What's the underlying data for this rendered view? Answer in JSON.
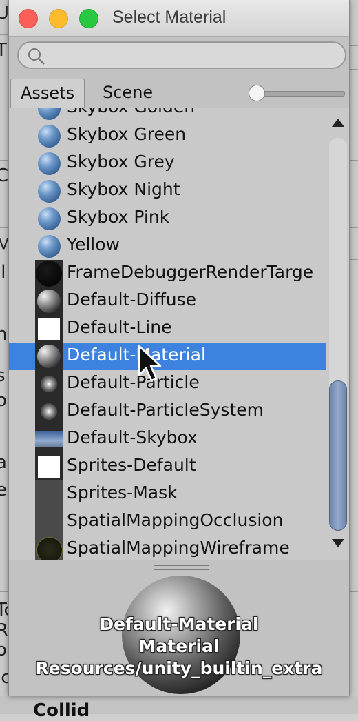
{
  "window": {
    "title": "Select Material"
  },
  "search": {
    "placeholder": ""
  },
  "tabs": [
    {
      "label": "Assets"
    },
    {
      "label": "Scene"
    }
  ],
  "materials": [
    {
      "label": "Skybox Golden",
      "thumb": "blue-sphere"
    },
    {
      "label": "Skybox Green",
      "thumb": "blue-sphere"
    },
    {
      "label": "Skybox Grey",
      "thumb": "blue-sphere"
    },
    {
      "label": "Skybox Night",
      "thumb": "blue-sphere"
    },
    {
      "label": "Skybox Pink",
      "thumb": "blue-sphere"
    },
    {
      "label": "Yellow",
      "thumb": "blue-sphere"
    },
    {
      "label": "FrameDebuggerRenderTarge",
      "thumb": "black-sphere"
    },
    {
      "label": "Default-Diffuse",
      "thumb": "grey-sphere"
    },
    {
      "label": "Default-Line",
      "thumb": "white-square"
    },
    {
      "label": "Default-Material",
      "thumb": "grey-sphere",
      "selected": true
    },
    {
      "label": "Default-Particle",
      "thumb": "particle-glow"
    },
    {
      "label": "Default-ParticleSystem",
      "thumb": "particle-glow"
    },
    {
      "label": "Default-Skybox",
      "thumb": "skybox-gradient"
    },
    {
      "label": "Sprites-Default",
      "thumb": "white-square"
    },
    {
      "label": "Sprites-Mask",
      "thumb": "dark-grey"
    },
    {
      "label": "SpatialMappingOcclusion",
      "thumb": "dark-grey"
    },
    {
      "label": "SpatialMappingWireframe",
      "thumb": "wireframe-sphere"
    }
  ],
  "preview": {
    "name": "Default-Material",
    "type": "Material",
    "path": "Resources/unity_builtin_extra"
  },
  "colors": {
    "selection": "#3e82e0",
    "scroll_thumb": "#7f95ba",
    "close": "#fc5f57",
    "minimize": "#fdbc2e",
    "maximize": "#28c840"
  }
}
